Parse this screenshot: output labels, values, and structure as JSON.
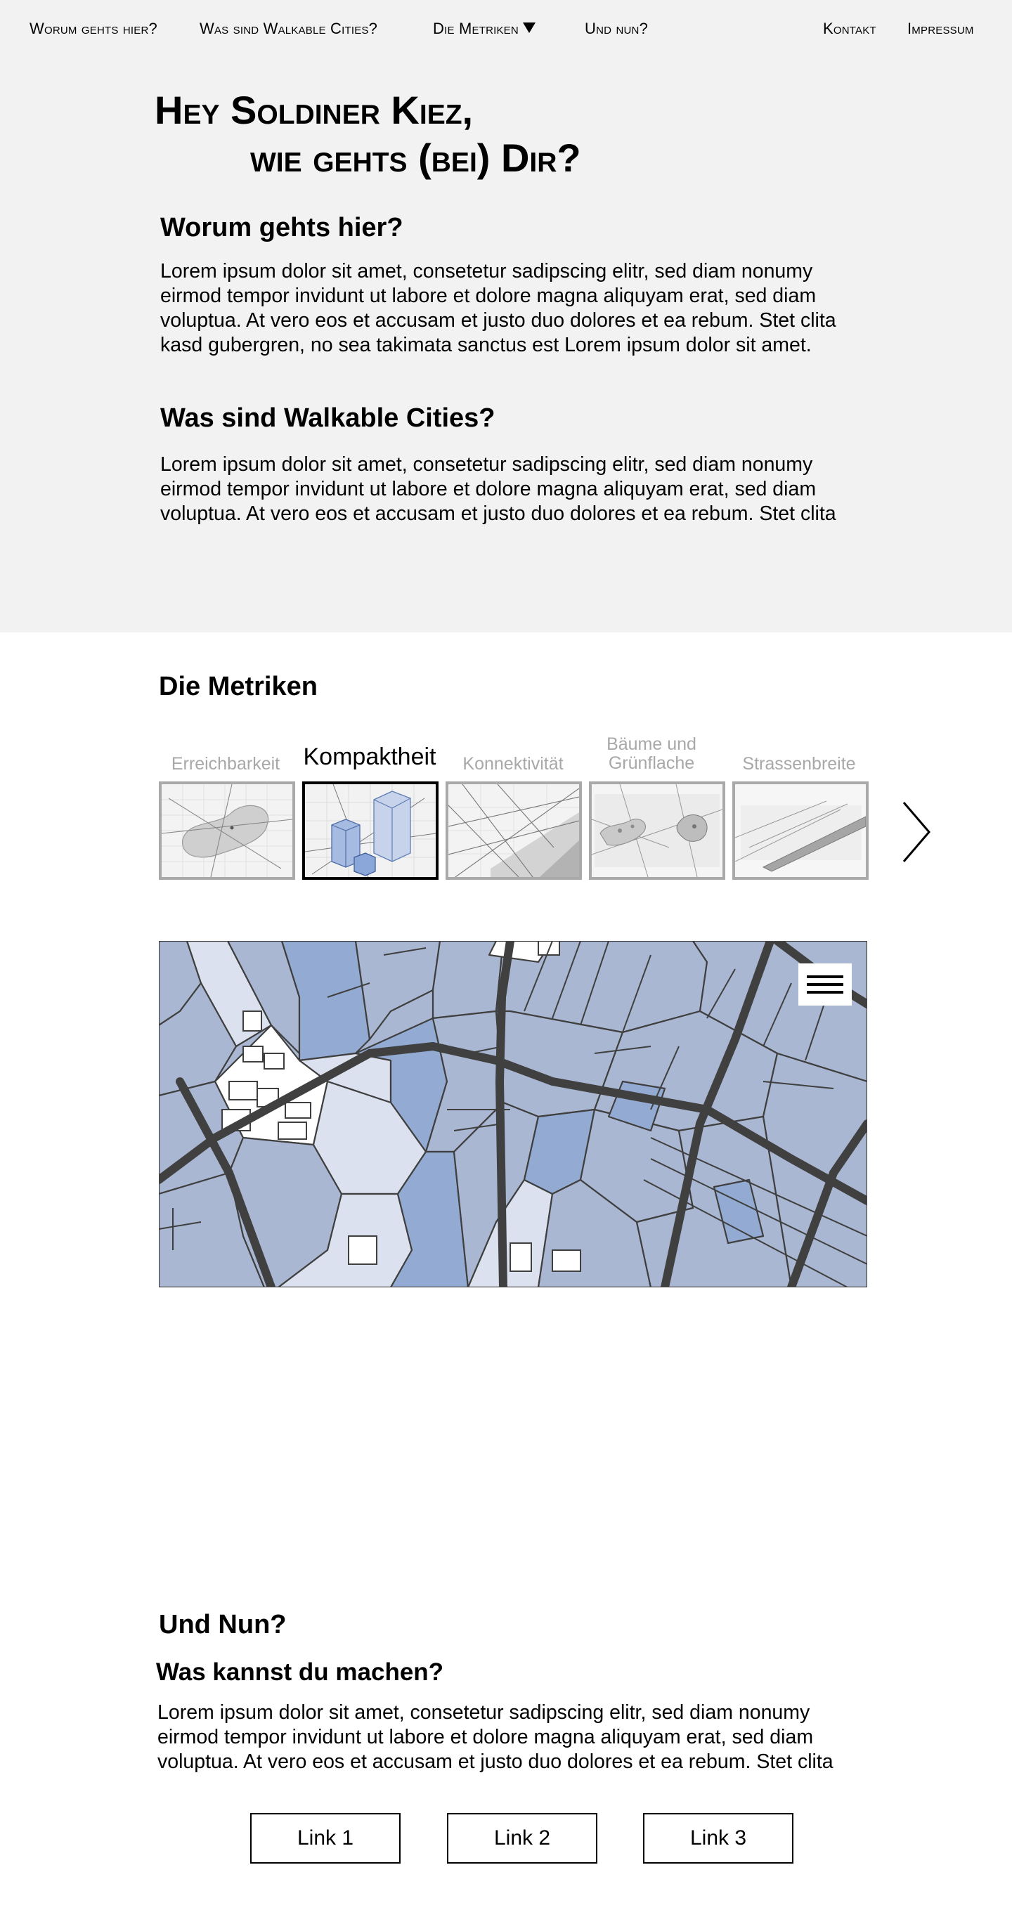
{
  "nav": {
    "items": [
      "Worum gehts hier?",
      "Was sind Walkable Cities?",
      "Die Metriken",
      "Und nun?"
    ],
    "right": [
      "Kontakt",
      "Impressum"
    ],
    "dropdown_icon": "triangle-down-icon"
  },
  "hero": {
    "title_line1": "Hey Soldiner Kiez,",
    "title_line2": "wie gehts (bei) Dir?",
    "section1": {
      "heading": "Worum gehts hier?",
      "text": "Lorem ipsum dolor sit amet, consetetur sadipscing elitr, sed diam nonumy eirmod tempor invidunt ut labore et dolore magna aliquyam erat, sed diam voluptua. At vero eos et accusam et justo duo dolores et ea rebum. Stet clita kasd gubergren, no sea takimata sanctus est Lorem ipsum dolor sit amet."
    },
    "section2": {
      "heading": "Was sind Walkable Cities?",
      "text": "Lorem ipsum dolor sit amet, consetetur sadipscing elitr, sed diam nonumy eirmod tempor invidunt ut labore et dolore magna aliquyam erat, sed diam voluptua. At vero eos et accusam et justo duo dolores et ea rebum. Stet clita"
    }
  },
  "metrics": {
    "heading": "Die Metriken",
    "items": [
      {
        "label": "Erreichbarkeit",
        "active": false
      },
      {
        "label": "Kompaktheit",
        "active": true
      },
      {
        "label": "Konnektivität",
        "active": false
      },
      {
        "label": "Bäume und Grünflache",
        "active": false
      },
      {
        "label": "Strassenbreite",
        "active": false
      }
    ],
    "next_icon": "chevron-right-icon",
    "map_menu_icon": "hamburger-menu-icon"
  },
  "colors": {
    "hero_bg": "#f2f2f2",
    "map_light": "#dbe1ee",
    "map_mid": "#a9b7d2",
    "map_dark": "#93abd3",
    "road": "#404040",
    "inactive_label": "#a8a8a8"
  },
  "undnun": {
    "heading": "Und Nun?",
    "subheading": "Was kannst du machen?",
    "text": "Lorem ipsum dolor sit amet, consetetur sadipscing elitr, sed diam nonumy eirmod tempor invidunt ut labore et dolore magna aliquyam erat, sed diam voluptua. At vero eos et accusam et justo duo dolores et ea rebum. Stet clita",
    "links": [
      "Link 1",
      "Link 2",
      "Link 3"
    ]
  }
}
